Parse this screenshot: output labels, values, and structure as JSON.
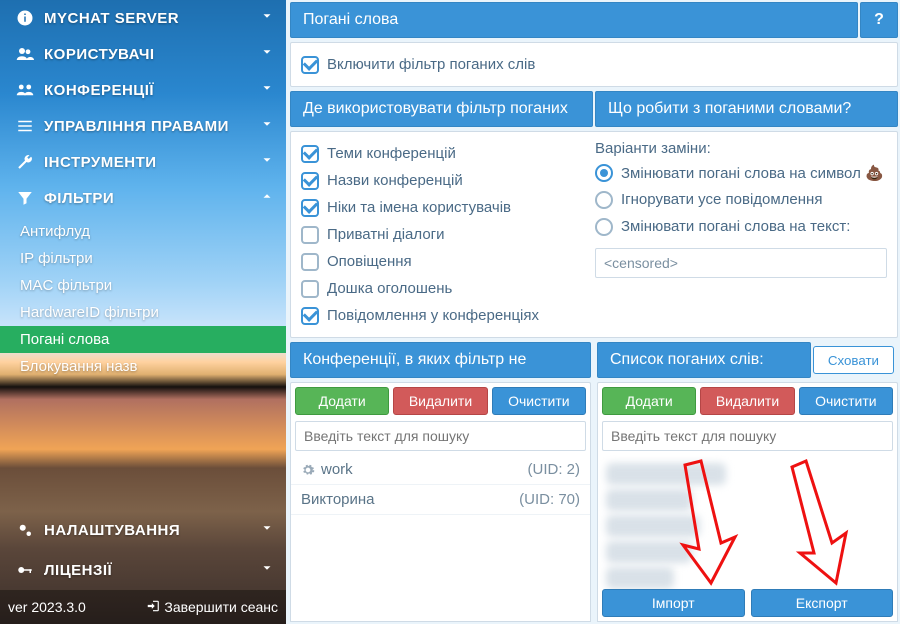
{
  "sidebar": {
    "items": [
      {
        "label": "MYCHAT SERVER",
        "expanded": false
      },
      {
        "label": "КОРИСТУВАЧІ",
        "expanded": false
      },
      {
        "label": "КОНФЕРЕНЦІЇ",
        "expanded": false
      },
      {
        "label": "УПРАВЛІННЯ ПРАВАМИ",
        "expanded": false
      },
      {
        "label": "ІНСТРУМЕНТИ",
        "expanded": false
      },
      {
        "label": "ФІЛЬТРИ",
        "expanded": true
      }
    ],
    "filters_sub": [
      "Антифлуд",
      "IP фільтри",
      "MAC фільтри",
      "HardwareID фільтри",
      "Погані слова",
      "Блокування назв"
    ],
    "footer": [
      {
        "label": "НАЛАШТУВАННЯ"
      },
      {
        "label": "ЛІЦЕНЗІЇ"
      }
    ],
    "version": "ver 2023.3.0",
    "logout": "Завершити сеанс"
  },
  "main": {
    "title": "Погані слова",
    "help": "?",
    "enable_label": "Включити фільтр поганих слів",
    "where_title": "Де використовувати фільтр поганих",
    "what_title": "Що робити з поганими словами?",
    "where": [
      {
        "label": "Теми конференцій",
        "on": true
      },
      {
        "label": "Назви конференцій",
        "on": true
      },
      {
        "label": "Ніки та імена користувачів",
        "on": true
      },
      {
        "label": "Приватні діалоги",
        "on": false
      },
      {
        "label": "Оповіщення",
        "on": false
      },
      {
        "label": "Дошка оголошень",
        "on": false
      },
      {
        "label": "Повідомлення у конференціях",
        "on": true
      }
    ],
    "variants_title": "Варіанти заміни:",
    "variants": [
      {
        "label": "Змінювати погані слова на символ 💩",
        "on": true
      },
      {
        "label": "Ігнорувати усе повідомлення",
        "on": false
      },
      {
        "label": "Змінювати погані слова на текст:",
        "on": false
      }
    ],
    "replace_text": "<censored>",
    "conf_title": "Конференції, в яких фільтр не",
    "words_title": "Список поганих слів:",
    "hide_btn": "Сховати",
    "btns": {
      "add": "Додати",
      "del": "Видалити",
      "clr": "Очистити"
    },
    "search_placeholder": "Введіть текст для пошуку",
    "conf_rows": [
      {
        "name": "work",
        "uid": "(UID: 2)",
        "gear": true
      },
      {
        "name": "Викторина",
        "uid": "(UID: 70)",
        "gear": false
      }
    ],
    "import": "Імпорт",
    "export": "Експорт"
  }
}
